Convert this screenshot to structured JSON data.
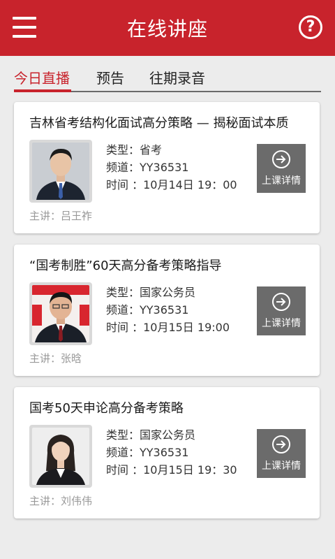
{
  "header": {
    "title": "在线讲座",
    "menu_icon": "hamburger-menu-icon",
    "help_icon": "help-question-icon",
    "accent": "#c8232c"
  },
  "tabs": [
    {
      "label": "今日直播",
      "active": true
    },
    {
      "label": "预告",
      "active": false
    },
    {
      "label": "往期录音",
      "active": false
    }
  ],
  "cards": [
    {
      "title": "吉林省考结构化面试高分策略 — 揭秘面试本质",
      "type_line": "类型：省考",
      "channel_line": "频道：YY36531",
      "time_line": "时间 ：10月14日 19：00",
      "button_label": "上课详情",
      "lecturer_line": "主讲：吕王祚"
    },
    {
      "title": "“国考制胜”60天高分备考策略指导",
      "type_line": "类型：国家公务员",
      "channel_line": "频道：YY36531",
      "time_line": "时间 ：10月15日 19:00",
      "button_label": "上课详情",
      "lecturer_line": "主讲：张晗"
    },
    {
      "title": "国考50天申论高分备考策略",
      "type_line": "类型：国家公务员",
      "channel_line": "频道：YY36531",
      "time_line": "时间 ：10月15日 19：30",
      "button_label": "上课详情",
      "lecturer_line": "主讲：刘伟伟"
    }
  ]
}
